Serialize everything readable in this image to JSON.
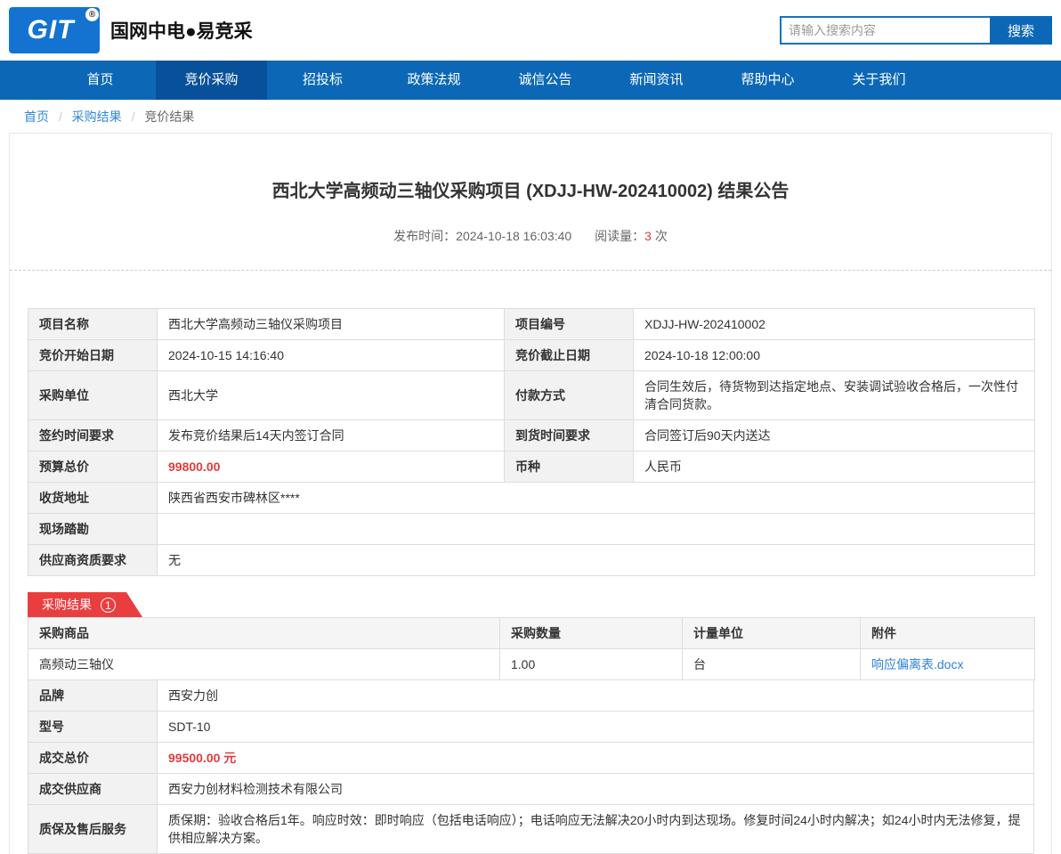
{
  "colors": {
    "nav_blue": "#0c68b7",
    "nav_active": "#09509a",
    "logo_blue": "#1473d0",
    "link_blue": "#3187d6",
    "red": "#e23b3b",
    "ribbon_red": "#ea3e3e"
  },
  "header": {
    "logo_text": "GIT",
    "logo_reg": "®",
    "brand": "国网中电●易竞采",
    "search": {
      "placeholder": "请输入搜索内容",
      "button": "搜索"
    }
  },
  "nav": {
    "items": [
      {
        "label": "首页"
      },
      {
        "label": "竞价采购"
      },
      {
        "label": "招投标"
      },
      {
        "label": "政策法规"
      },
      {
        "label": "诚信公告"
      },
      {
        "label": "新闻资讯"
      },
      {
        "label": "帮助中心"
      },
      {
        "label": "关于我们"
      }
    ]
  },
  "breadcrumb": {
    "separator": "/",
    "items": [
      "首页",
      "采购结果",
      "竞价结果"
    ]
  },
  "article": {
    "title": "西北大学高频动三轴仪采购项目 (XDJJ-HW-202410002) 结果公告",
    "publish_label": "发布时间：",
    "publish_time": "2024-10-18 16:03:40",
    "views_label": "阅读量：",
    "views_count": "3",
    "views_unit": "次"
  },
  "info_table": {
    "rows": [
      {
        "l1": "项目名称",
        "v1": "西北大学高频动三轴仪采购项目",
        "l2": "项目编号",
        "v2": "XDJJ-HW-202410002"
      },
      {
        "l1": "竞价开始日期",
        "v1": "2024-10-15 14:16:40",
        "l2": "竞价截止日期",
        "v2": "2024-10-18 12:00:00"
      },
      {
        "l1": "采购单位",
        "v1": "西北大学",
        "l2": "付款方式",
        "v2": "合同生效后，待货物到达指定地点、安装调试验收合格后，一次性付清合同货款。"
      },
      {
        "l1": "签约时间要求",
        "v1": "发布竞价结果后14天内签订合同",
        "l2": "到货时间要求",
        "v2": "合同签订后90天内送达"
      },
      {
        "l1": "预算总价",
        "v1": "99800.00",
        "l2": "币种",
        "v2": "人民币"
      },
      {
        "l1": "收货地址",
        "v1": "陕西省西安市碑林区****"
      },
      {
        "l1": "现场踏勘",
        "v1": ""
      },
      {
        "l1": "供应商资质要求",
        "v1": "无"
      }
    ]
  },
  "result_section": {
    "ribbon_label": "采购结果",
    "ribbon_badge": "1",
    "product_table": {
      "headers": [
        "采购商品",
        "采购数量",
        "计量单位",
        "附件"
      ],
      "row": {
        "product": "高频动三轴仪",
        "quantity": "1.00",
        "unit": "台",
        "attachment": "响应偏离表.docx"
      }
    },
    "detail_rows": [
      {
        "label": "品牌",
        "value": "西安力创"
      },
      {
        "label": "型号",
        "value": "SDT-10"
      },
      {
        "label": "成交总价",
        "value": "99500.00 元"
      },
      {
        "label": "成交供应商",
        "value": "西安力创材料检测技术有限公司"
      },
      {
        "label": "质保及售后服务",
        "value": "质保期：验收合格后1年。响应时效：即时响应（包括电话响应）；电话响应无法解决20小时内到达现场。修复时间24小时内解决；如24小时内无法修复，提供相应解决方案。"
      }
    ]
  }
}
